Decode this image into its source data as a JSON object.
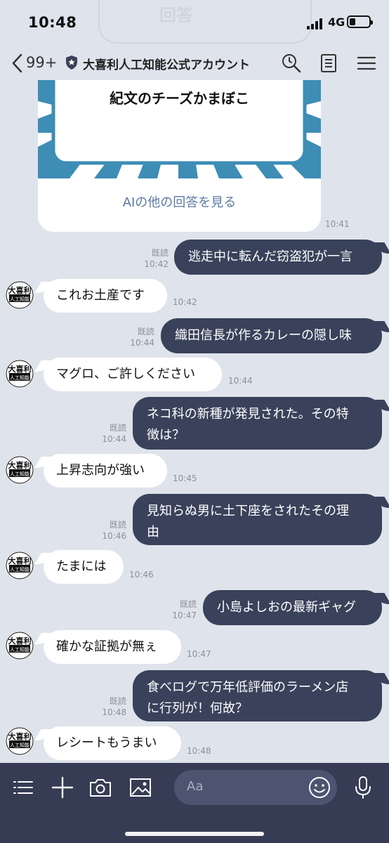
{
  "status": {
    "time": "10:48",
    "network": "4G"
  },
  "ghost_label": "回答",
  "header": {
    "unread": "99+",
    "account_name": "大喜利人工知能公式アカウント"
  },
  "card": {
    "title": "紀文のチーズかまぼこ",
    "link": "AIの他の回答を見る",
    "time": "10:41"
  },
  "avatar_text": {
    "line1": "大喜利",
    "line2": "人工知能"
  },
  "messages": [
    {
      "text": "逃走中に転んだ窃盗犯が一言",
      "read": "既読",
      "time": "10:42"
    },
    {
      "text": "これお土産です",
      "time": "10:42"
    },
    {
      "text": "織田信長が作るカレーの隠し味",
      "read": "既読",
      "time": "10:44"
    },
    {
      "text": "マグロ、ご許しください",
      "time": "10:44"
    },
    {
      "line1": "ネコ科の新種が発見された。その特",
      "line2": "徴は？",
      "read": "既読",
      "time": "10:44"
    },
    {
      "text": "上昇志向が強い",
      "time": "10:45"
    },
    {
      "line1": "見知らぬ男に土下座をされたその理",
      "line2": "由",
      "read": "既読",
      "time": "10:46"
    },
    {
      "text": "たまには",
      "time": "10:46"
    },
    {
      "text": "小島よしおの最新ギャグ",
      "read": "既読",
      "time": "10:47"
    },
    {
      "text": "確かな証拠が無ぇ",
      "time": "10:47"
    },
    {
      "line1": "食べログで万年低評価のラーメン店",
      "line2": "に行列が！何故？",
      "read": "既読",
      "time": "10:48"
    },
    {
      "text": "レシートもうまい",
      "time": "10:48"
    }
  ],
  "input": {
    "placeholder": "Aa"
  },
  "icons": [
    "back-icon",
    "shield-icon",
    "search-icon",
    "notes-icon",
    "menu-icon",
    "list-icon",
    "plus-icon",
    "camera-icon",
    "image-icon",
    "emoji-icon",
    "mic-icon"
  ],
  "colors": {
    "outgoing": "#39425a",
    "background": "#dfe3eb",
    "input_bar": "#353c54",
    "link": "#5b7aa3"
  }
}
